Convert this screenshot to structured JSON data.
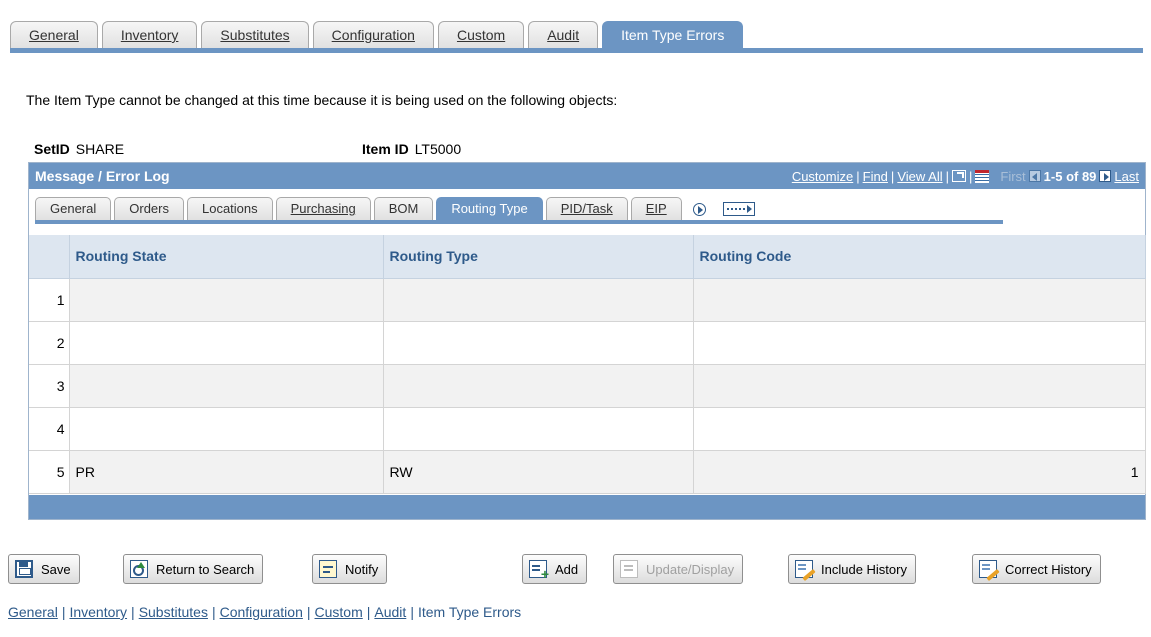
{
  "top_tabs": [
    {
      "label": "General",
      "active": false
    },
    {
      "label": "Inventory",
      "active": false
    },
    {
      "label": "Substitutes",
      "active": false
    },
    {
      "label": "Configuration",
      "active": false
    },
    {
      "label": "Custom",
      "active": false
    },
    {
      "label": "Audit",
      "active": false
    },
    {
      "label": "Item Type Errors",
      "active": true
    }
  ],
  "intro_text": "The Item Type cannot be changed at this time because it is being used on the following objects:",
  "keys": {
    "setid_label": "SetID",
    "setid_value": "SHARE",
    "itemid_label": "Item ID",
    "itemid_value": "LT5000"
  },
  "grid": {
    "title": "Message / Error Log",
    "nav": {
      "customize": "Customize",
      "find": "Find",
      "view_all": "View All",
      "first": "First",
      "range": "1-5 of 89",
      "last": "Last",
      "separator": "|"
    },
    "sub_tabs": [
      {
        "label": "General",
        "active": false
      },
      {
        "label": "Orders",
        "active": false
      },
      {
        "label": "Locations",
        "active": false
      },
      {
        "label": "Purchasing",
        "active": false
      },
      {
        "label": "BOM",
        "active": false
      },
      {
        "label": "Routing Type",
        "active": true
      },
      {
        "label": "PID/Task",
        "active": false
      },
      {
        "label": "EIP",
        "active": false
      }
    ],
    "columns": [
      "Routing State",
      "Routing Type",
      "Routing Code"
    ],
    "rows": [
      {
        "num": "1",
        "routing_state": "",
        "routing_type": "",
        "routing_code": ""
      },
      {
        "num": "2",
        "routing_state": "",
        "routing_type": "",
        "routing_code": ""
      },
      {
        "num": "3",
        "routing_state": "",
        "routing_type": "",
        "routing_code": ""
      },
      {
        "num": "4",
        "routing_state": "",
        "routing_type": "",
        "routing_code": ""
      },
      {
        "num": "5",
        "routing_state": "PR",
        "routing_type": "RW",
        "routing_code": "1"
      }
    ]
  },
  "buttons": {
    "save": "Save",
    "return_to_search": "Return to Search",
    "notify": "Notify",
    "add": "Add",
    "update_display": "Update/Display",
    "include_history": "Include History",
    "correct_history": "Correct History"
  },
  "footer_links": [
    {
      "label": "General",
      "link": true
    },
    {
      "label": "Inventory",
      "link": true
    },
    {
      "label": "Substitutes",
      "link": true
    },
    {
      "label": "Configuration",
      "link": true
    },
    {
      "label": "Custom",
      "link": true
    },
    {
      "label": "Audit",
      "link": true
    },
    {
      "label": "Item Type Errors",
      "link": false
    }
  ],
  "colors": {
    "accent": "#6c95c3",
    "header_text": "#2e5a8a"
  }
}
